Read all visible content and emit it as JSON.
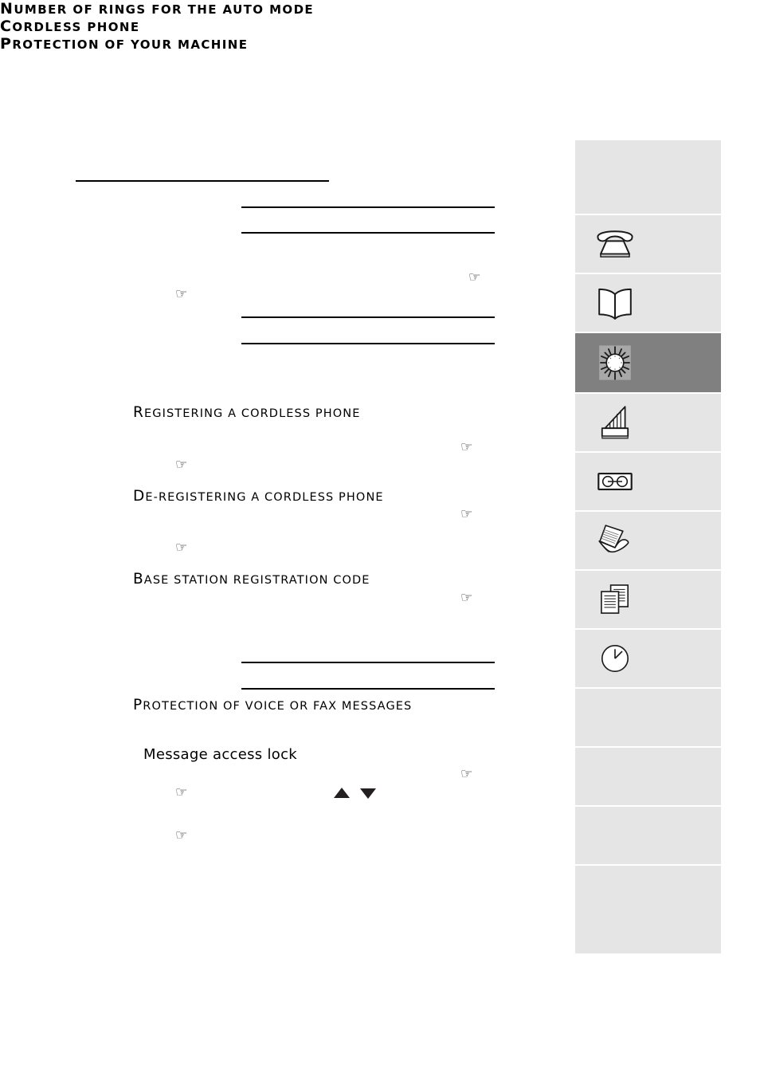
{
  "document": {
    "type": "fax-machine-user-manual-page",
    "page_background": "#ffffff"
  },
  "content": {
    "top_rule": "",
    "sections": [
      {
        "id": "number-of-rings",
        "kind": "section-band",
        "title": "Number of rings for the auto mode"
      },
      {
        "id": "cordless-phone",
        "kind": "section-band",
        "title": "Cordless phone"
      },
      {
        "id": "protection-of-your-machine",
        "kind": "section-band",
        "title": "Protection of your machine"
      }
    ],
    "subheadings": [
      {
        "id": "registering-a-cordless-phone",
        "title": "Registering a cordless phone"
      },
      {
        "id": "de-registering-a-cordless-phone",
        "title": "De-registering a cordless phone"
      },
      {
        "id": "base-station-registration-code",
        "title": "Base station registration code"
      },
      {
        "id": "protection-of-voice-or-fax-messages",
        "title": "Protection of voice or fax messages"
      }
    ],
    "plain_headings": [
      {
        "id": "message-access-lock",
        "title": "Message access lock"
      }
    ],
    "pointer_marks": [
      {
        "id": "pointer-1",
        "glyph": "☞"
      },
      {
        "id": "pointer-2",
        "glyph": "☞"
      },
      {
        "id": "pointer-3",
        "glyph": "☞"
      },
      {
        "id": "pointer-4",
        "glyph": "☞"
      },
      {
        "id": "pointer-5",
        "glyph": "☞"
      },
      {
        "id": "pointer-6",
        "glyph": "☞"
      },
      {
        "id": "pointer-7",
        "glyph": "☞"
      },
      {
        "id": "pointer-8",
        "glyph": "☞"
      },
      {
        "id": "pointer-9",
        "glyph": "☞"
      },
      {
        "id": "pointer-10",
        "glyph": "☞"
      }
    ],
    "nav_arrows": [
      {
        "id": "arrow-up",
        "direction": "up"
      },
      {
        "id": "arrow-down",
        "direction": "down"
      }
    ]
  },
  "sidebar": {
    "colors": {
      "tab_background": "#e5e5e5",
      "tab_active_background": "#808080",
      "icon_stroke": "#1a1a1a"
    },
    "tabs": [
      {
        "id": "tab-blank-top",
        "icon": "none",
        "label": "",
        "active": false
      },
      {
        "id": "tab-telephone",
        "icon": "telephone-icon",
        "label": "",
        "active": false
      },
      {
        "id": "tab-directory",
        "icon": "open-book-icon",
        "label": "",
        "active": false
      },
      {
        "id": "tab-setup",
        "icon": "dial-sun-icon",
        "label": "",
        "active": true
      },
      {
        "id": "tab-answering-machine",
        "icon": "signal-bars-icon",
        "label": "",
        "active": false
      },
      {
        "id": "tab-cassette",
        "icon": "cassette-tape-icon",
        "label": "",
        "active": false
      },
      {
        "id": "tab-fax-send",
        "icon": "fax-document-icon",
        "label": "",
        "active": false
      },
      {
        "id": "tab-copy",
        "icon": "copy-pages-icon",
        "label": "",
        "active": false
      },
      {
        "id": "tab-clock",
        "icon": "clock-icon",
        "label": "",
        "active": false
      },
      {
        "id": "tab-blank-1",
        "icon": "none",
        "label": "",
        "active": false
      },
      {
        "id": "tab-blank-2",
        "icon": "none",
        "label": "",
        "active": false
      },
      {
        "id": "tab-blank-3",
        "icon": "none",
        "label": "",
        "active": false
      },
      {
        "id": "tab-blank-4",
        "icon": "none",
        "label": "",
        "active": false
      }
    ]
  }
}
